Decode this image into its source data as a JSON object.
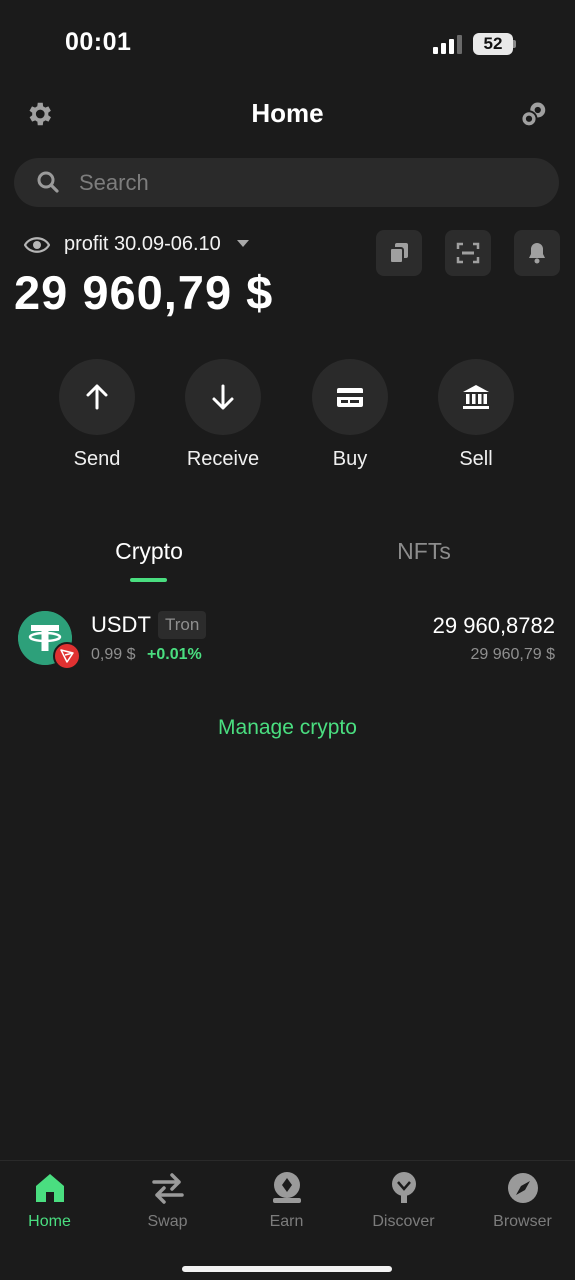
{
  "status_bar": {
    "time": "00:01",
    "battery": "52"
  },
  "header": {
    "title": "Home"
  },
  "search": {
    "placeholder": "Search"
  },
  "wallet": {
    "name": "profit 30.09-06.10",
    "balance": "29 960,79 $"
  },
  "actions": [
    {
      "label": "Send",
      "icon": "arrow-up-icon"
    },
    {
      "label": "Receive",
      "icon": "arrow-down-icon"
    },
    {
      "label": "Buy",
      "icon": "card-icon"
    },
    {
      "label": "Sell",
      "icon": "bank-icon"
    }
  ],
  "tabs": [
    {
      "label": "Crypto",
      "active": true
    },
    {
      "label": "NFTs",
      "active": false
    }
  ],
  "assets": [
    {
      "symbol": "USDT",
      "network": "Tron",
      "price": "0,99 $",
      "change": "+0.01%",
      "amount": "29 960,8782",
      "value": "29 960,79 $"
    }
  ],
  "manage_label": "Manage crypto",
  "bottom_nav": [
    {
      "label": "Home",
      "icon": "home-icon",
      "active": true
    },
    {
      "label": "Swap",
      "icon": "swap-icon",
      "active": false
    },
    {
      "label": "Earn",
      "icon": "earn-icon",
      "active": false
    },
    {
      "label": "Discover",
      "icon": "discover-icon",
      "active": false
    },
    {
      "label": "Browser",
      "icon": "compass-icon",
      "active": false
    }
  ],
  "colors": {
    "accent": "#4ade80",
    "background": "#1b1b1b",
    "surface": "#2a2a2a",
    "tether": "#2da07a",
    "tron": "#e03131"
  }
}
